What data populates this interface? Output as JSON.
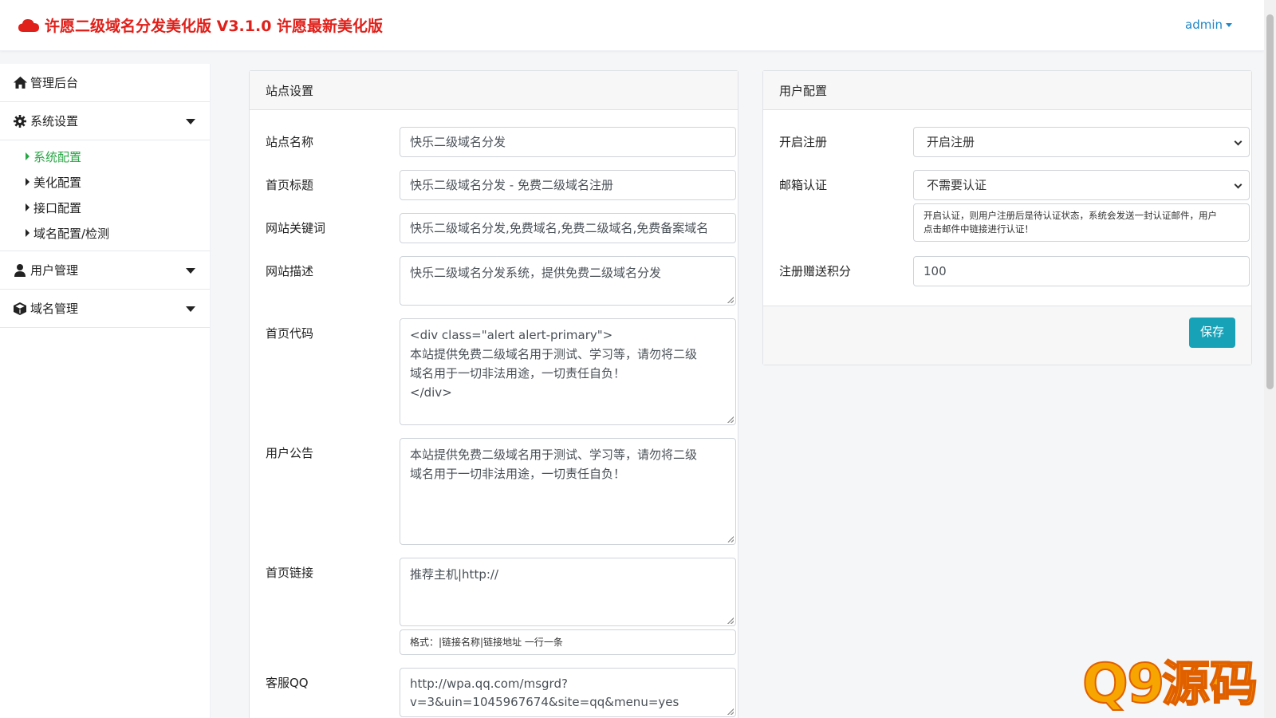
{
  "header": {
    "title": "许愿二级域名分发美化版 V3.1.0 许愿最新美化版",
    "user": "admin",
    "brand_color": "#e0201a",
    "accent_color": "#1e88c8"
  },
  "sidebar": {
    "dashboard": {
      "icon": "home-icon",
      "label": "管理后台"
    },
    "system": {
      "icon": "gear-icon",
      "label": "系统设置",
      "items": [
        {
          "label": "系统配置",
          "active": true
        },
        {
          "label": "美化配置"
        },
        {
          "label": "接口配置"
        },
        {
          "label": "域名配置/检测"
        }
      ]
    },
    "users": {
      "icon": "user-icon",
      "label": "用户管理"
    },
    "domains": {
      "icon": "cube-icon",
      "label": "域名管理"
    }
  },
  "site_panel": {
    "title": "站点设置",
    "site_name": {
      "label": "站点名称",
      "value": "快乐二级域名分发"
    },
    "home_title": {
      "label": "首页标题",
      "value": "快乐二级域名分发 - 免费二级域名注册"
    },
    "keywords": {
      "label": "网站关键词",
      "value": "快乐二级域名分发,免费域名,免费二级域名,免费备案域名"
    },
    "description": {
      "label": "网站描述",
      "value": "快乐二级域名分发系统，提供免费二级域名分发"
    },
    "home_code": {
      "label": "首页代码",
      "line1": "<div class=\"alert alert-primary\">",
      "line2": "本站提供免费二级域名用于测试、学习等，请勿将二级",
      "line3": "域名用于一切非法用途，一切责任自负！",
      "line4": "</div>"
    },
    "notice": {
      "label": "用户公告",
      "line1": "本站提供免费二级域名用于测试、学习等，请勿将二级",
      "line2": "域名用于一切非法用途，一切责任自负！"
    },
    "home_links": {
      "label": "首页链接",
      "value": "推荐主机|http://",
      "hint": "格式：|链接名称|链接地址 一行一条"
    },
    "qq": {
      "label": "客服QQ",
      "line1": "http://wpa.qq.com/msgrd?",
      "line2": "v=3&uin=1045967674&site=qq&menu=yes"
    }
  },
  "user_panel": {
    "title": "用户配置",
    "register": {
      "label": "开启注册",
      "value": "开启注册"
    },
    "email_verify": {
      "label": "邮箱认证",
      "value": "不需要认证",
      "note1": "开启认证，则用户注册后是待认证状态，系统会发送一封认证邮件，用户",
      "note2": "点击邮件中链接进行认证！"
    },
    "bonus": {
      "label": "注册赠送积分",
      "value": "100"
    },
    "save_label": "保存",
    "save_color": "#17a2b8"
  },
  "watermark": {
    "text": "Q9源码"
  }
}
